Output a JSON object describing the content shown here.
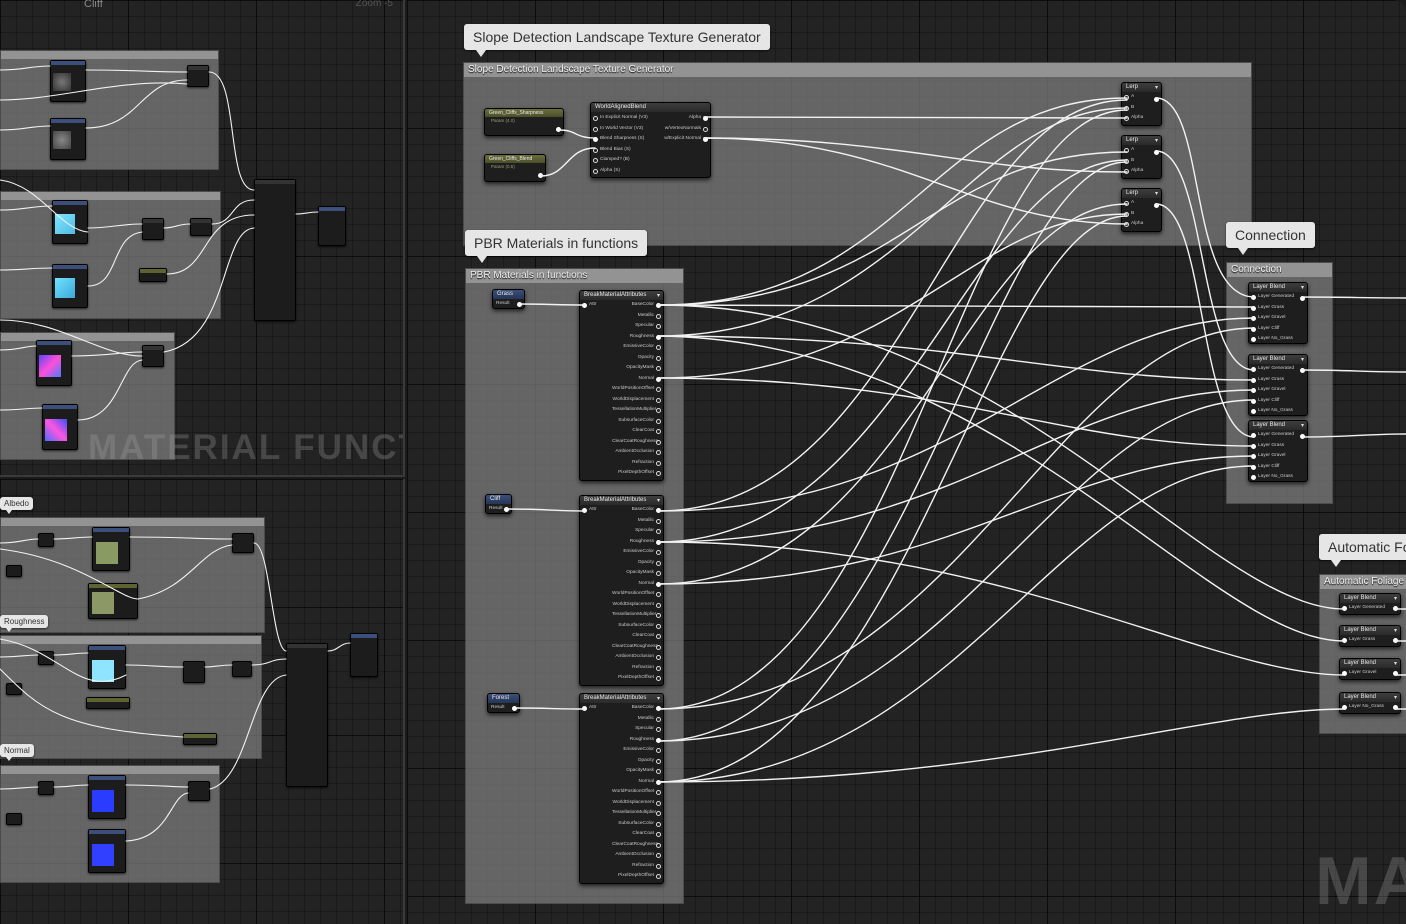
{
  "top_left": {
    "graph_title": "Cliff",
    "zoom": "Zoom -5",
    "watermark": "MATERIAL FUNCTION"
  },
  "bottom_left": {
    "tags": [
      "Albedo",
      "Roughness",
      "Normal"
    ]
  },
  "main": {
    "watermark": "MA",
    "slope_group": {
      "bubble": "Slope Detection Landscape Texture Generator",
      "header": "Slope Detection Landscape Texture Generator",
      "param_a": "Green_Cliffs_Sharpness",
      "param_a_sub": "Param (4.0)",
      "param_b": "Green_Cliffs_Blend",
      "param_b_sub": "Param (0.5)",
      "world_aligned": {
        "title": "WorldAlignedBlend",
        "inputs": [
          "In Explicit Normal (V3)",
          "In World Vector (V3)",
          "Blend Sharpness (S)",
          "Blend Bias (S)",
          "Clamped? (B)",
          "Alpha (S)"
        ],
        "outputs": [
          "Alpha",
          "w/VertexNormals",
          "w/Explicit Normal"
        ]
      },
      "lerp": {
        "title": "Lerp",
        "pins": [
          "A",
          "B",
          "Alpha"
        ]
      }
    },
    "pbr_group": {
      "bubble": "PBR Materials in functions",
      "header": "PBR Materials in functions",
      "func_nodes": [
        {
          "title": "Grass",
          "pin": "Result"
        },
        {
          "title": "Cliff",
          "pin": "Result"
        },
        {
          "title": "Forest",
          "pin": "Result"
        }
      ],
      "break_node": {
        "title": "BreakMaterialAttributes",
        "input": "Attr",
        "outputs": [
          "BaseColor",
          "Metallic",
          "Specular",
          "Roughness",
          "EmissiveColor",
          "Opacity",
          "OpacityMask",
          "Normal",
          "WorldPositionOffset",
          "WorldDisplacement",
          "TessellationMultiplier",
          "SubsurfaceColor",
          "ClearCoat",
          "ClearCoatRoughness",
          "AmbientOcclusion",
          "Refraction",
          "PixelDepthOffset"
        ]
      }
    },
    "connection_group": {
      "bubble": "Connection",
      "header": "Connection",
      "layer_blend": {
        "title": "Layer Blend",
        "pins": [
          "Layer Generated",
          "Layer Grass",
          "Layer Gravel",
          "Layer Cliff",
          "Layer No_Grass"
        ]
      }
    },
    "foliage_group": {
      "bubble": "Automatic Fo",
      "header": "Automatic Foliage",
      "nodes": [
        {
          "title": "Layer Blend",
          "pin": "Layer Generated"
        },
        {
          "title": "Layer Blend",
          "pin": "Layer Grass"
        },
        {
          "title": "Layer Blend",
          "pin": "Layer Gravel"
        },
        {
          "title": "Layer Blend",
          "pin": "Layer No_Grass"
        }
      ]
    }
  }
}
